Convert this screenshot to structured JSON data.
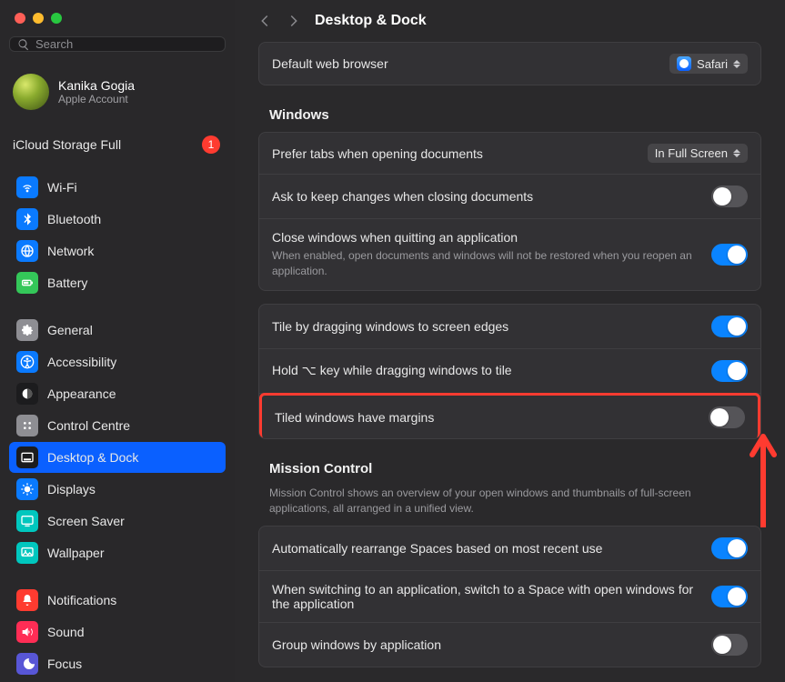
{
  "search": {
    "placeholder": "Search"
  },
  "account": {
    "name": "Kanika Gogia",
    "sub": "Apple Account"
  },
  "storage": {
    "label": "iCloud Storage Full",
    "badge": "1"
  },
  "sidebar": {
    "group1": [
      {
        "label": "Wi-Fi",
        "bg": "#0a7aff",
        "icon": "wifi"
      },
      {
        "label": "Bluetooth",
        "bg": "#0a7aff",
        "icon": "bluetooth"
      },
      {
        "label": "Network",
        "bg": "#0a7aff",
        "icon": "network"
      },
      {
        "label": "Battery",
        "bg": "#34c759",
        "icon": "battery"
      }
    ],
    "group2": [
      {
        "label": "General",
        "bg": "#8e8e93",
        "icon": "gear"
      },
      {
        "label": "Accessibility",
        "bg": "#0a7aff",
        "icon": "accessibility"
      },
      {
        "label": "Appearance",
        "bg": "#1c1c1e",
        "icon": "appearance"
      },
      {
        "label": "Control Centre",
        "bg": "#8e8e93",
        "icon": "control"
      },
      {
        "label": "Desktop & Dock",
        "bg": "#1c1c1e",
        "icon": "dock",
        "selected": true
      },
      {
        "label": "Displays",
        "bg": "#0a7aff",
        "icon": "displays"
      },
      {
        "label": "Screen Saver",
        "bg": "#00c7be",
        "icon": "screensaver"
      },
      {
        "label": "Wallpaper",
        "bg": "#00c7be",
        "icon": "wallpaper"
      }
    ],
    "group3": [
      {
        "label": "Notifications",
        "bg": "#ff3b30",
        "icon": "bell"
      },
      {
        "label": "Sound",
        "bg": "#ff2d55",
        "icon": "sound"
      },
      {
        "label": "Focus",
        "bg": "#5856d6",
        "icon": "focus"
      }
    ]
  },
  "header": {
    "title": "Desktop & Dock"
  },
  "browserRow": {
    "label": "Default web browser",
    "value": "Safari"
  },
  "windowsSection": {
    "title": "Windows"
  },
  "windowsRows": {
    "preferTabs": {
      "label": "Prefer tabs when opening documents",
      "value": "In Full Screen"
    },
    "askKeep": {
      "label": "Ask to keep changes when closing documents",
      "on": false
    },
    "closeQuit": {
      "label": "Close windows when quitting an application",
      "desc": "When enabled, open documents and windows will not be restored when you reopen an application.",
      "on": true
    }
  },
  "tilingRows": {
    "tileEdges": {
      "label": "Tile by dragging windows to screen edges",
      "on": true
    },
    "holdOption": {
      "label": "Hold ⌥ key while dragging windows to tile",
      "on": true
    },
    "margins": {
      "label": "Tiled windows have margins",
      "on": false
    }
  },
  "missionSection": {
    "title": "Mission Control",
    "desc": "Mission Control shows an overview of your open windows and thumbnails of full-screen applications, all arranged in a unified view."
  },
  "missionRows": {
    "autoRearrange": {
      "label": "Automatically rearrange Spaces based on most recent use",
      "on": true
    },
    "switchSpace": {
      "label": "When switching to an application, switch to a Space with open windows for the application",
      "on": true
    },
    "groupWindows": {
      "label": "Group windows by application",
      "on": false
    }
  }
}
